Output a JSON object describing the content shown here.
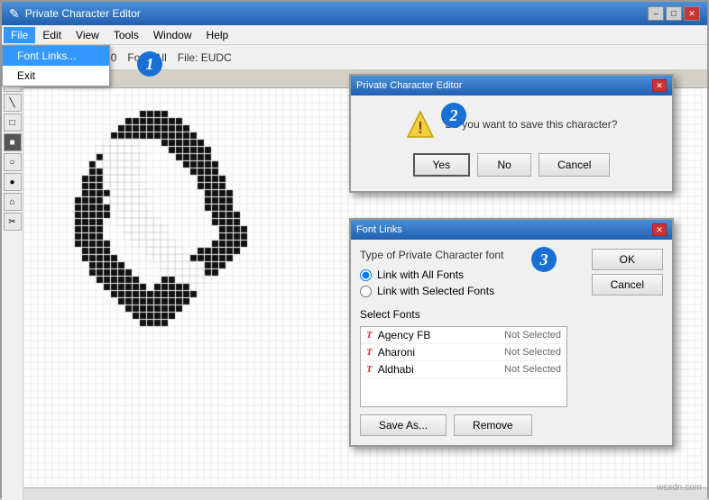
{
  "window": {
    "title": "Private Character Editor",
    "controls": {
      "minimize": "–",
      "maximize": "□",
      "close": "✕"
    }
  },
  "menubar": {
    "items": [
      "File",
      "Edit",
      "View",
      "Tools",
      "Window",
      "Help"
    ]
  },
  "file_menu": {
    "items": [
      "Font Links...",
      "Exit"
    ],
    "highlighted": "Font Links..."
  },
  "toolbar": {
    "code_label": "Code: E040",
    "font_label": "Font: All",
    "file_label": "File: EUDC",
    "edit_label": "Edit"
  },
  "tools": {
    "icons": [
      "✎",
      "╱",
      "□",
      "■",
      "○",
      "●",
      "⌂",
      "✂"
    ]
  },
  "save_dialog": {
    "title": "Private Character Editor",
    "message": "Do you want to save this character?",
    "buttons": [
      "Yes",
      "No",
      "Cancel"
    ]
  },
  "font_links_dialog": {
    "title": "Font Links",
    "section_label": "Type of Private Character font",
    "radio_options": [
      "Link with All Fonts",
      "Link with Selected Fonts"
    ],
    "selected_radio": 0,
    "select_fonts_label": "Select Fonts",
    "fonts": [
      {
        "icon": "T",
        "name": "Agency FB",
        "status": "Not Selected"
      },
      {
        "icon": "T",
        "name": "Aharoni",
        "status": "Not Selected"
      },
      {
        "icon": "T",
        "name": "Aldhabi",
        "status": "Not Selected"
      }
    ],
    "buttons": {
      "ok": "OK",
      "cancel": "Cancel",
      "save_as": "Save As...",
      "remove": "Remove"
    }
  },
  "badges": {
    "one": "1",
    "two": "2",
    "three": "3"
  },
  "watermark": "wsxdn.com"
}
